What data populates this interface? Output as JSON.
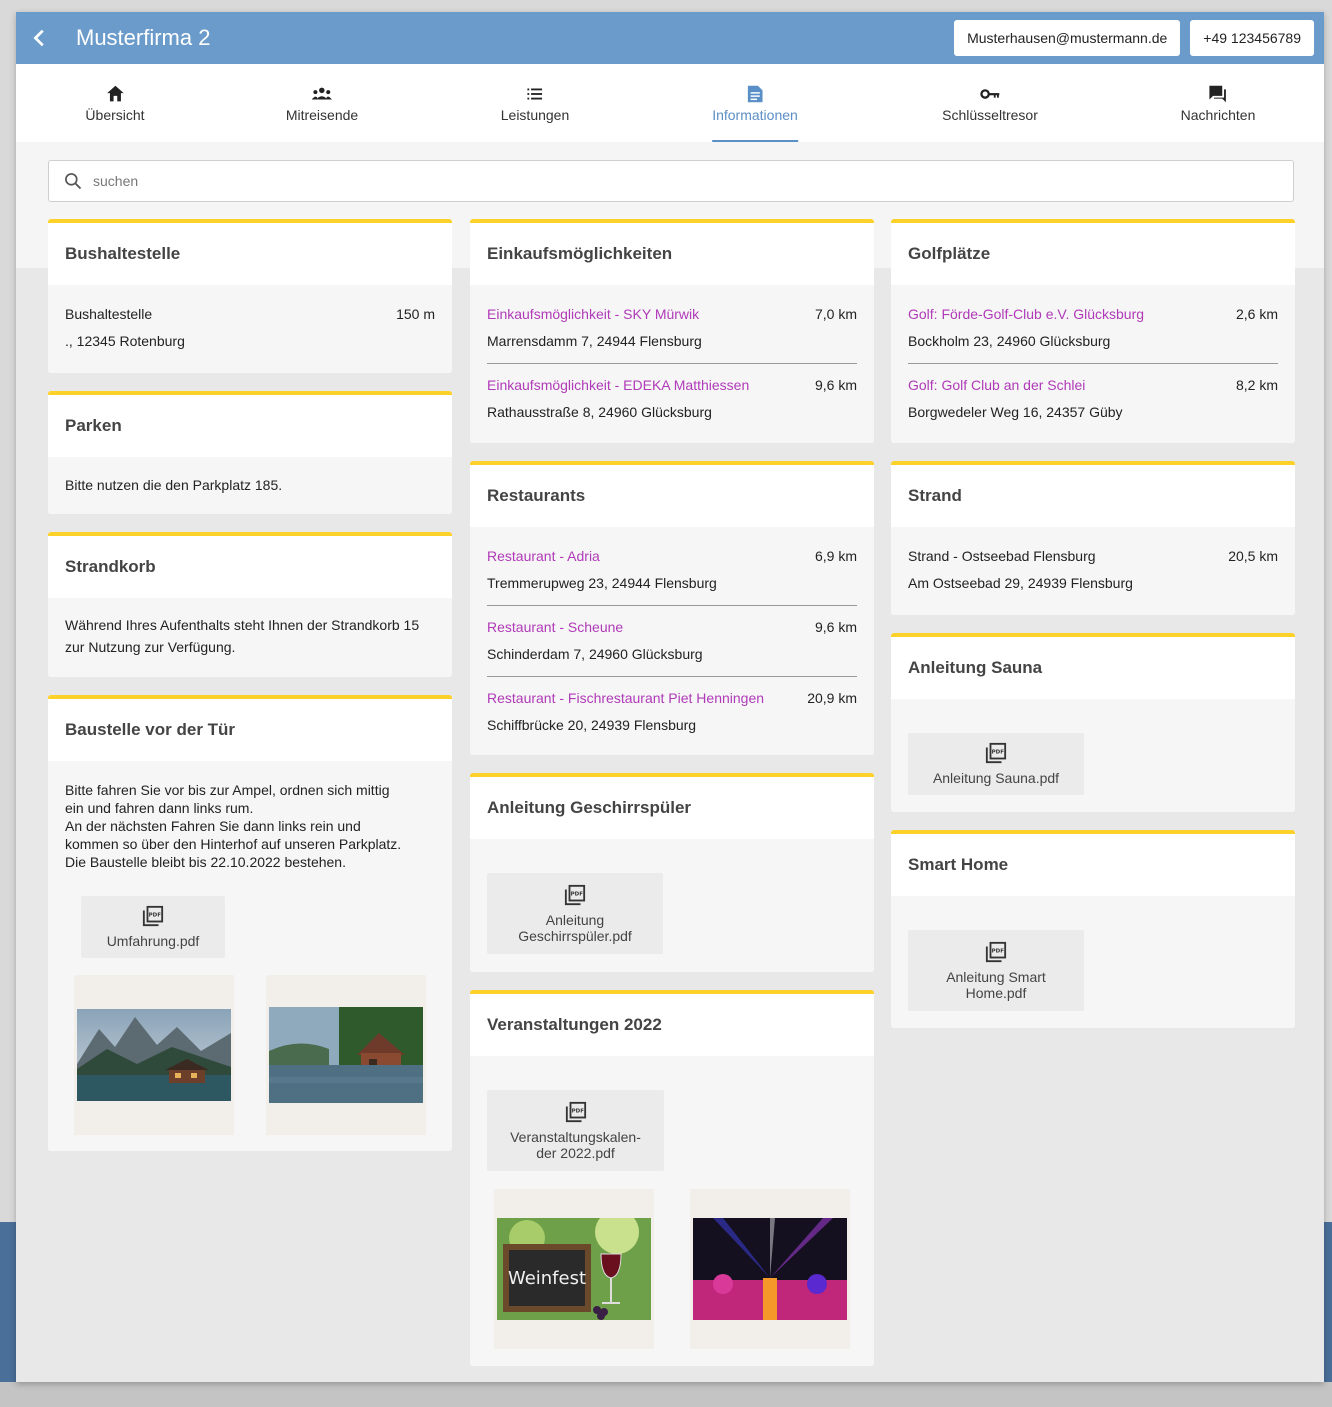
{
  "header": {
    "title": "Musterfirma 2",
    "email": "Musterhausen@mustermann.de",
    "phone": "+49 123456789"
  },
  "nav": [
    {
      "label": "Übersicht",
      "icon": "home-icon"
    },
    {
      "label": "Mitreisende",
      "icon": "group-icon"
    },
    {
      "label": "Leistungen",
      "icon": "list-icon"
    },
    {
      "label": "Informationen",
      "icon": "document-icon",
      "active": true
    },
    {
      "label": "Schlüsseltresor",
      "icon": "key-icon"
    },
    {
      "label": "Nachrichten",
      "icon": "chat-icon"
    }
  ],
  "search": {
    "placeholder": "suchen"
  },
  "bus": {
    "title": "Bushaltestelle",
    "name": "Bushaltestelle",
    "distance": "150 m",
    "address": "., 12345 Rotenburg"
  },
  "parken": {
    "title": "Parken",
    "text": "Bitte nutzen die den Parkplatz 185."
  },
  "strandkorb": {
    "title": "Strandkorb",
    "text": "Während Ihres Aufenthalts steht Ihnen der Strandkorb 15 zur Nutzung zur Verfügung."
  },
  "baustelle": {
    "title": "Baustelle vor der Tür",
    "lines": [
      "Bitte fahren Sie vor bis zur Ampel, ordnen sich mittig",
      "ein und fahren dann links rum.",
      "An der nächsten Fahren Sie dann links rein und",
      "kommen so über den Hinterhof auf unseren Parkplatz.",
      "Die Baustelle bleibt bis 22.10.2022 bestehen."
    ],
    "pdf": "Umfahrung.pdf"
  },
  "einkauf": {
    "title": "Einkaufsmöglichkeiten",
    "items": [
      {
        "name": "Einkaufsmöglichkeit - SKY Mürwik",
        "distance": "7,0 km",
        "address": "Marrensdamm 7, 24944 Flensburg"
      },
      {
        "name": "Einkaufsmöglichkeit - EDEKA Matthiessen",
        "distance": "9,6 km",
        "address": "Rathausstraße 8, 24960 Glücksburg"
      }
    ]
  },
  "restaurants": {
    "title": "Restaurants",
    "items": [
      {
        "name": "Restaurant - Adria",
        "distance": "6,9 km",
        "address": "Tremmerupweg 23, 24944 Flensburg"
      },
      {
        "name": "Restaurant - Scheune",
        "distance": "9,6 km",
        "address": "Schinderdam 7, 24960 Glücksburg"
      },
      {
        "name": "Restaurant - Fischrestaurant Piet Henningen",
        "distance": "20,9 km",
        "address": "Schiffbrücke 20, 24939 Flensburg"
      }
    ]
  },
  "geschirr": {
    "title": "Anleitung Geschirrspüler",
    "pdf_line1": "Anleitung",
    "pdf_line2": "Geschirrspüler.pdf"
  },
  "veranstaltungen": {
    "title": "Veranstaltungen 2022",
    "pdf_line1": "Veranstaltungskalen-",
    "pdf_line2": "der 2022.pdf",
    "weinfest": "Weinfest"
  },
  "golf": {
    "title": "Golfplätze",
    "items": [
      {
        "name": "Golf: Förde-Golf-Club e.V. Glücksburg",
        "distance": "2,6 km",
        "address": "Bockholm 23, 24960 Glücksburg"
      },
      {
        "name": "Golf: Golf Club an der Schlei",
        "distance": "8,2 km",
        "address": "Borgwedeler Weg 16, 24357 Güby"
      }
    ]
  },
  "strand": {
    "title": "Strand",
    "name": "Strand - Ostseebad Flensburg",
    "distance": "20,5 km",
    "address": "Am Ostseebad 29, 24939 Flensburg"
  },
  "sauna": {
    "title": "Anleitung Sauna",
    "pdf": "Anleitung Sauna.pdf"
  },
  "smarthome": {
    "title": "Smart Home",
    "pdf_line1": "Anleitung Smart",
    "pdf_line2": "Home.pdf"
  },
  "colors": {
    "header": "#6a9bcb",
    "accent": "#fcd22a",
    "link": "#b03ab8",
    "active_tab": "#5b8fc7"
  }
}
